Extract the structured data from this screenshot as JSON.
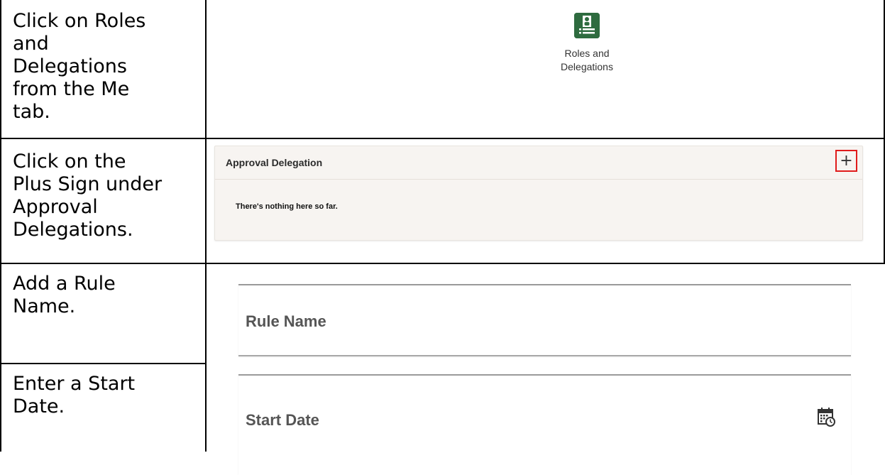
{
  "steps": [
    {
      "instruction": "Click on Roles\nand\nDelegations\nfrom the Me\ntab.",
      "tile": {
        "label": "Roles and\nDelegations",
        "icon": "contact-card-icon",
        "color": "#2e6b3f"
      }
    },
    {
      "instruction": "Click on the\nPlus Sign under\nApproval\nDelegations.",
      "panel": {
        "title": "Approval Delegation",
        "add_label": "+",
        "empty_text": "There's nothing here so far.",
        "highlight_color": "#e01b1b"
      }
    },
    {
      "instruction": "Add a Rule\nName.",
      "field": {
        "label": "Rule Name"
      }
    },
    {
      "instruction": "Enter a Start\nDate.",
      "field": {
        "label": "Start Date",
        "icon": "calendar-clock-icon"
      }
    }
  ]
}
